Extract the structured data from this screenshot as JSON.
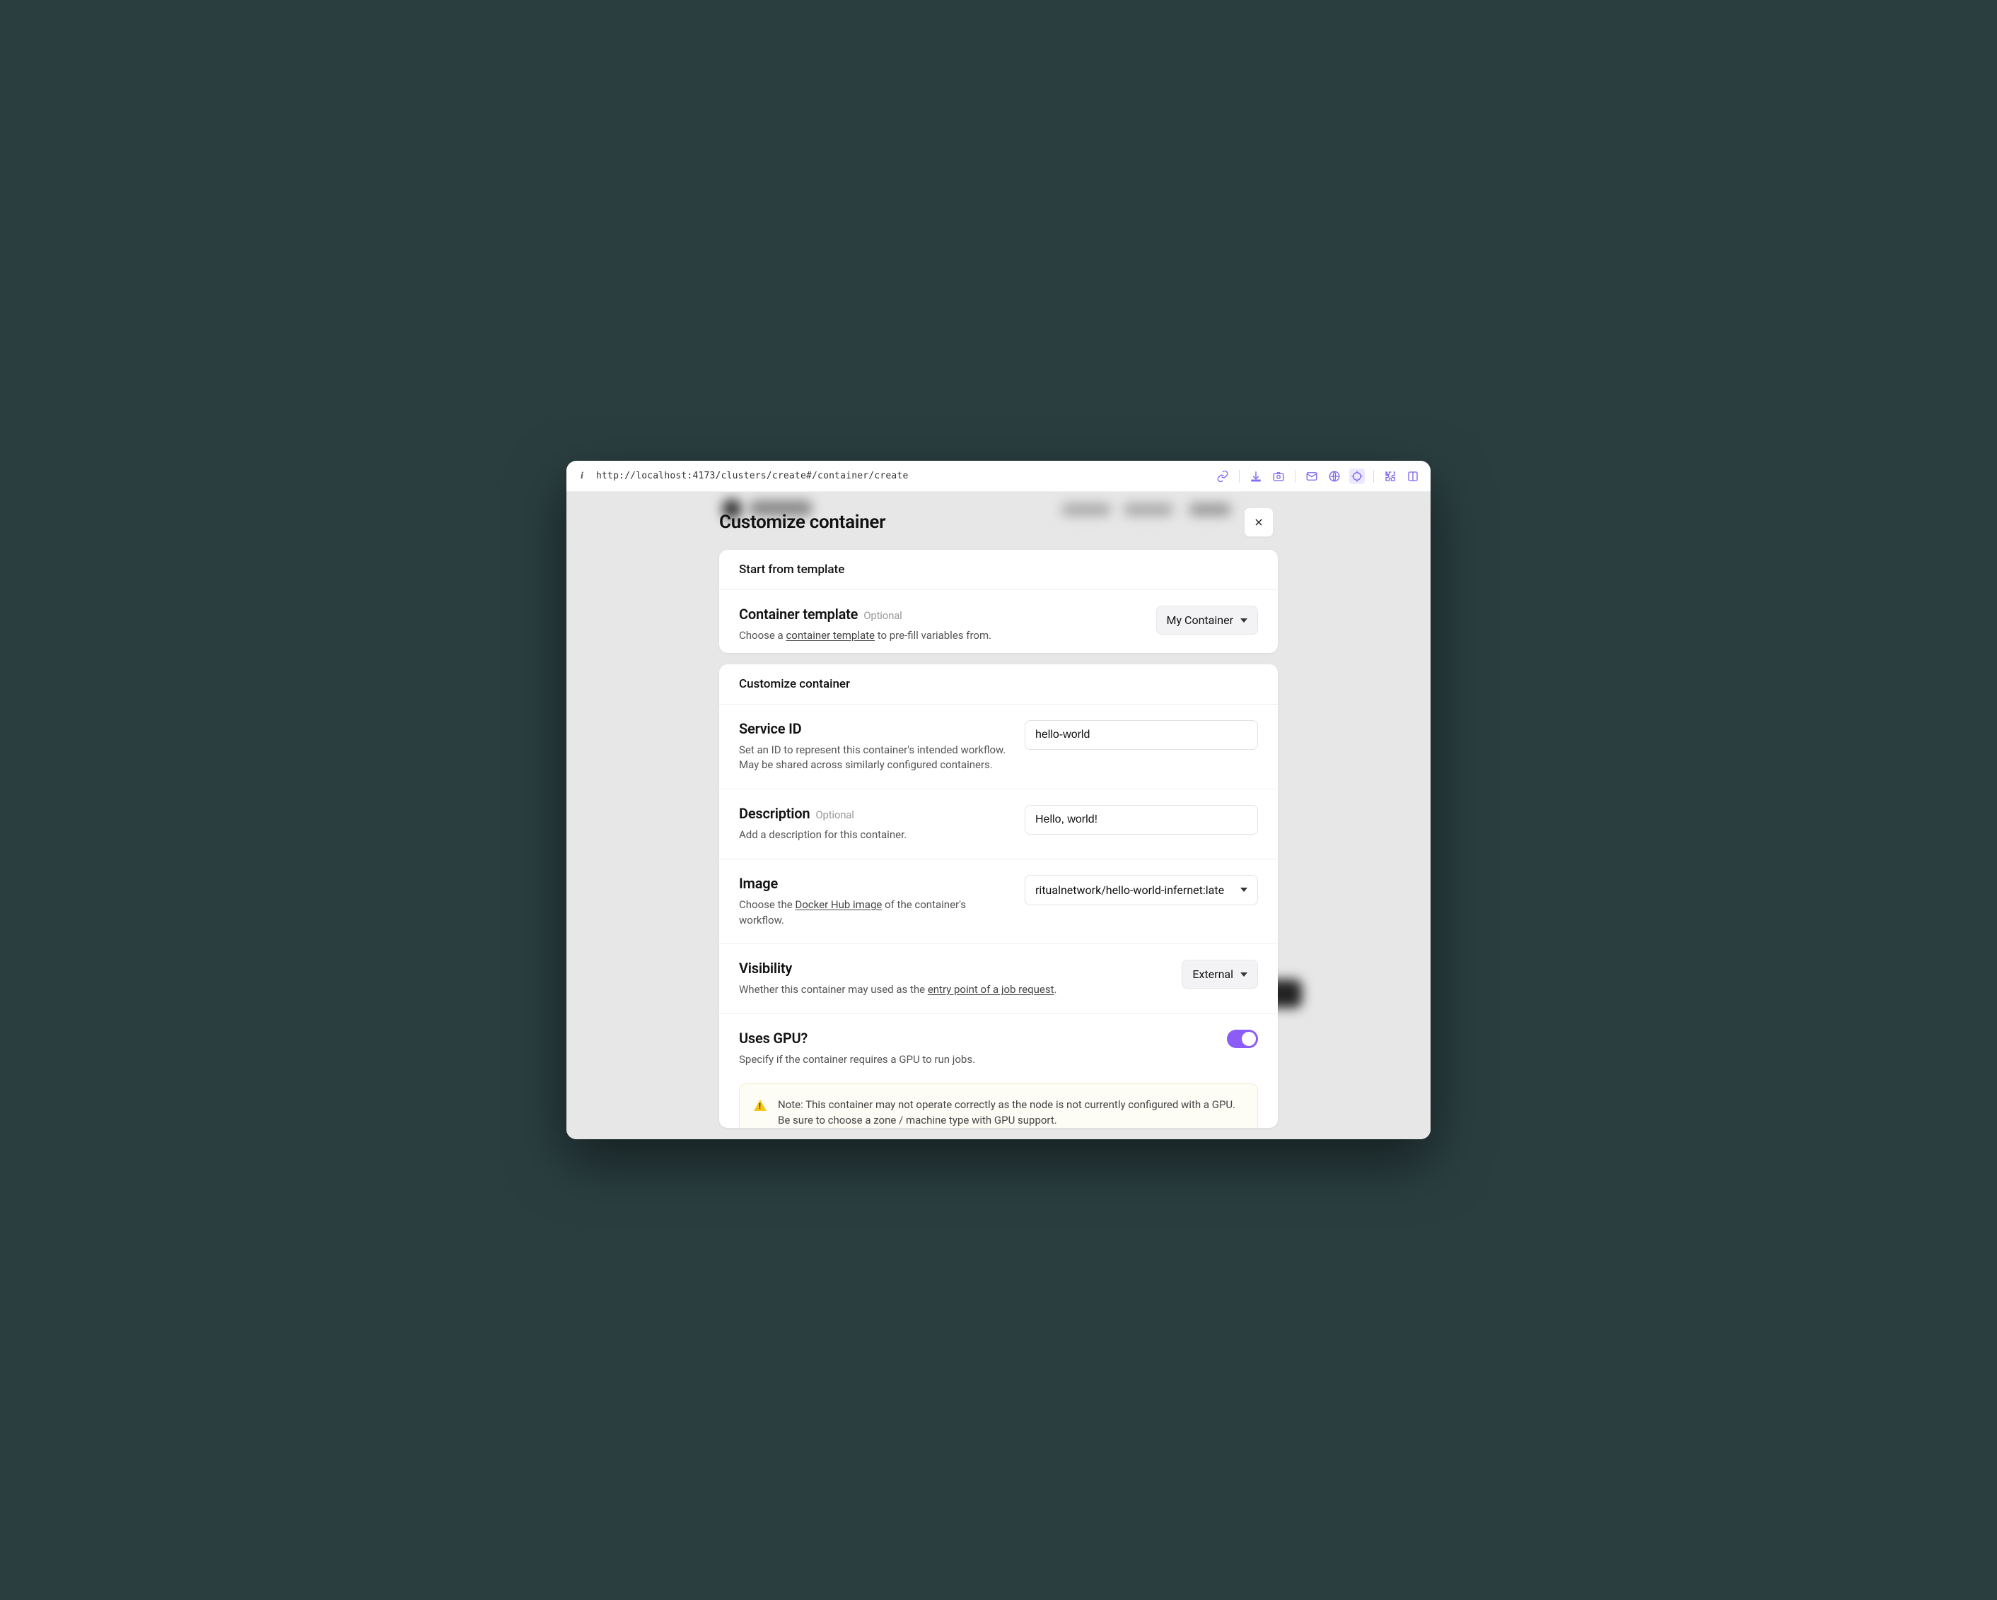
{
  "url": "http://localhost:4173/clusters/create#/container/create",
  "modal": {
    "title": "Customize container",
    "card1": {
      "header": "Start from template",
      "template": {
        "title": "Container template",
        "optional": "Optional",
        "desc_pre": "Choose a ",
        "desc_link": "container template",
        "desc_post": " to pre-fill variables from.",
        "value": "My Container"
      }
    },
    "card2": {
      "header": "Customize container",
      "service_id": {
        "title": "Service ID",
        "desc": "Set an ID to represent this container's intended workflow. May be shared across similarly configured containers.",
        "value": "hello-world"
      },
      "description": {
        "title": "Description",
        "optional": "Optional",
        "desc": "Add a description for this container.",
        "value": "Hello, world!"
      },
      "image": {
        "title": "Image",
        "desc_pre": "Choose the ",
        "desc_link": "Docker Hub image",
        "desc_post": " of the container's workflow.",
        "value": "ritualnetwork/hello-world-infernet:late"
      },
      "visibility": {
        "title": "Visibility",
        "desc_pre": "Whether this container may used as the ",
        "desc_link": "entry point of a job request",
        "desc_post": ".",
        "value": "External"
      },
      "gpu": {
        "title": "Uses GPU?",
        "desc": "Specify if the container requires a GPU to run jobs.",
        "on": true,
        "note": "Note: This container may not operate correctly as the node is not currently configured with a GPU. Be sure to choose a zone / machine type with GPU support."
      }
    }
  }
}
